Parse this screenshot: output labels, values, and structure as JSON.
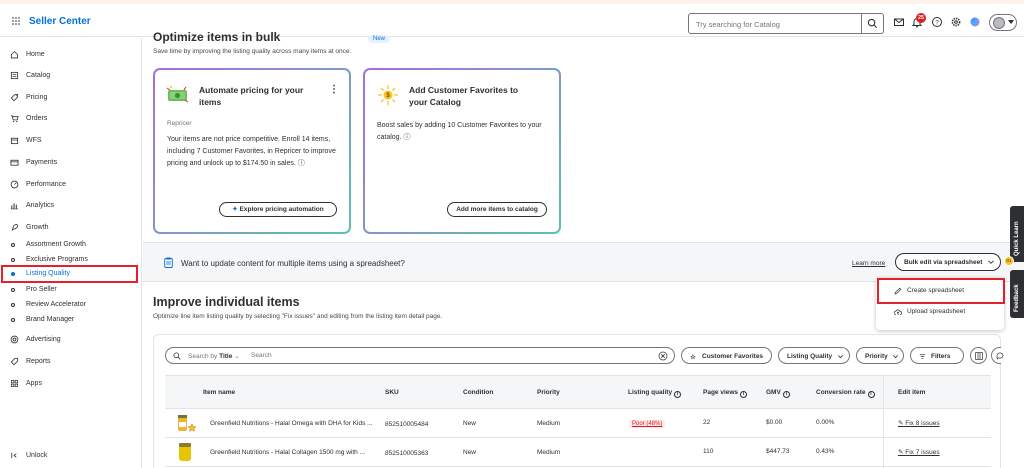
{
  "header": {
    "brand": "Seller Center",
    "search_placeholder": "Try searching for Catalog",
    "notification_count": "25",
    "accent": "#0071dc"
  },
  "sidebar": {
    "items": [
      {
        "label": "Home",
        "icon": "home-icon"
      },
      {
        "label": "Catalog",
        "icon": "catalog-icon"
      },
      {
        "label": "Pricing",
        "icon": "tag-icon"
      },
      {
        "label": "Orders",
        "icon": "cart-icon"
      },
      {
        "label": "WFS",
        "icon": "box-icon"
      },
      {
        "label": "Payments",
        "icon": "card-icon"
      },
      {
        "label": "Performance",
        "icon": "gauge-icon"
      },
      {
        "label": "Analytics",
        "icon": "bar-chart-icon"
      },
      {
        "label": "Growth",
        "icon": "rocket-icon"
      }
    ],
    "growth_sub": [
      {
        "label": "Assortment Growth"
      },
      {
        "label": "Exclusive Programs"
      },
      {
        "label": "Listing Quality",
        "active": true
      },
      {
        "label": "Pro Seller"
      },
      {
        "label": "Review Accelerator"
      },
      {
        "label": "Brand Manager"
      }
    ],
    "items2": [
      {
        "label": "Advertising",
        "icon": "megaphone-icon"
      },
      {
        "label": "Reports",
        "icon": "report-icon"
      },
      {
        "label": "Apps",
        "icon": "apps-icon"
      }
    ],
    "unlock": "Unlock"
  },
  "bulk_section": {
    "title": "Optimize items in bulk",
    "new_badge": "New",
    "subtitle": "Save time by improving the listing quality across many items at once."
  },
  "cards": [
    {
      "title": "Automate pricing for your items",
      "category": "Repricer",
      "body": "Your items are not price competitive. Enroll 14 items, including 7 Customer Favorites, in Repricer to improve pricing and unlock up to $174.50 in sales. ⓘ",
      "button": "Explore pricing automation"
    },
    {
      "title": "Add Customer Favorites to your Catalog",
      "body": "Boost sales by adding 10 Customer Favorites to your catalog. ⓘ",
      "button": "Add more items to catalog"
    }
  ],
  "banner": {
    "text": "Want to update content for multiple items using a spreadsheet?",
    "learn_more": "Learn more",
    "bulk_button": "Bulk edit via spreadsheet"
  },
  "dropdown": {
    "items": [
      "Create spreadsheet",
      "Upload spreadsheet"
    ]
  },
  "improve": {
    "title": "Improve individual items",
    "subtitle": "Optimize line item listing quality by selecting \"Fix issues\" and editing from the listing item detail page."
  },
  "toolbar": {
    "search_by": "Search by",
    "search_by_field": "Title",
    "search_placeholder": "Search",
    "chips": [
      "Customer Favorites",
      "Listing Quality",
      "Priority",
      "Filters"
    ]
  },
  "table": {
    "columns": [
      "Item name",
      "SKU",
      "Condition",
      "Priority",
      "Listing quality",
      "Page views",
      "GMV",
      "Conversion rate",
      "Edit item"
    ],
    "rows": [
      {
        "name": "Greenfield Nutritions - Halal Omega with DHA for Kids ...",
        "sku": "852510005484",
        "condition": "New",
        "priority": "Medium",
        "quality": "Poor (48%)",
        "views": "22",
        "gmv": "$0.00",
        "conversion": "0.00%",
        "edit": "Fix 8 issues"
      },
      {
        "name": "Greenfield Nutritions - Halal Collagen 1500 mg with ...",
        "sku": "852510005363",
        "condition": "New",
        "priority": "Medium",
        "quality": "",
        "views": "110",
        "gmv": "$447.73",
        "conversion": "0.43%",
        "edit": "Fix 7 issues"
      }
    ]
  },
  "side_tabs": {
    "quick_learn": "Quick Learn",
    "feedback": "Feedback",
    "dot_count": "01"
  }
}
